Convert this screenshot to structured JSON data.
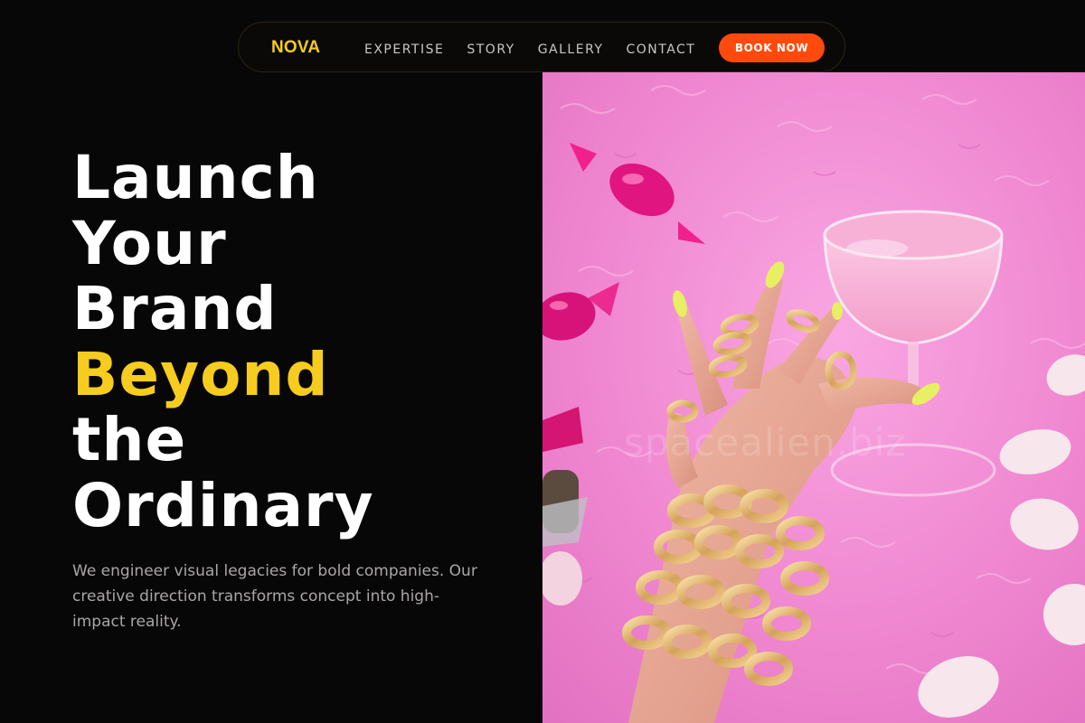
{
  "nav": {
    "brand": "NOVA",
    "links": [
      "EXPERTISE",
      "STORY",
      "GALLERY",
      "CONTACT"
    ],
    "cta_label": "BOOK NOW"
  },
  "hero": {
    "title_lines": [
      "Launch",
      "Your",
      "Brand"
    ],
    "title_accent": "Beyond",
    "title_tail": [
      "the",
      "Ordinary"
    ],
    "description": "We engineer visual legacies for bold companies. Our creative direction transforms concept into high-impact reality.",
    "image": {
      "watermark": "spacealien.biz"
    }
  },
  "colors": {
    "background": "#080708",
    "accent": "#f6cc1f",
    "cta": "#ff4a0d",
    "text_primary": "#ffffff",
    "text_muted": "#a9a6a6",
    "nav_link": "#c8c8c8",
    "photo_pink": "#f28ad2"
  }
}
